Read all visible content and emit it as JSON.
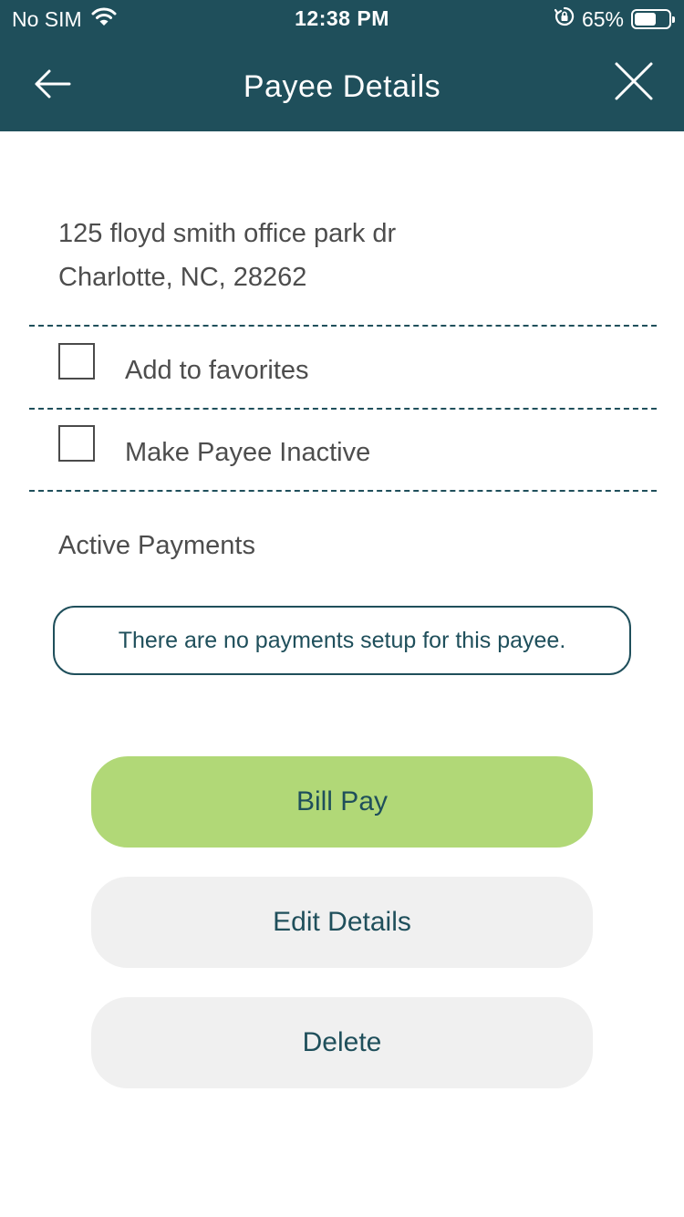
{
  "status_bar": {
    "carrier": "No SIM",
    "time": "12:38 PM",
    "battery_percent": "65%",
    "battery_level": 0.65,
    "wifi_icon": "wifi-icon",
    "rotation_lock_icon": "rotation-lock-icon"
  },
  "header": {
    "title": "Payee Details",
    "back_icon": "arrow-left-icon",
    "close_icon": "close-icon"
  },
  "address": {
    "line1": "125 floyd smith office park dr",
    "line2": "Charlotte, NC, 28262"
  },
  "options": {
    "favorites_label": "Add to favorites",
    "favorites_checked": false,
    "inactive_label": "Make Payee Inactive",
    "inactive_checked": false
  },
  "active_payments": {
    "title": "Active Payments",
    "empty_message": "There are no payments setup for this payee."
  },
  "actions": {
    "bill_pay_label": "Bill Pay",
    "edit_label": "Edit Details",
    "delete_label": "Delete"
  },
  "colors": {
    "header_bg": "#1f4f5b",
    "primary_button": "#b1d877",
    "secondary_button": "#f0f0f0",
    "text_accent": "#1f4f5b"
  }
}
